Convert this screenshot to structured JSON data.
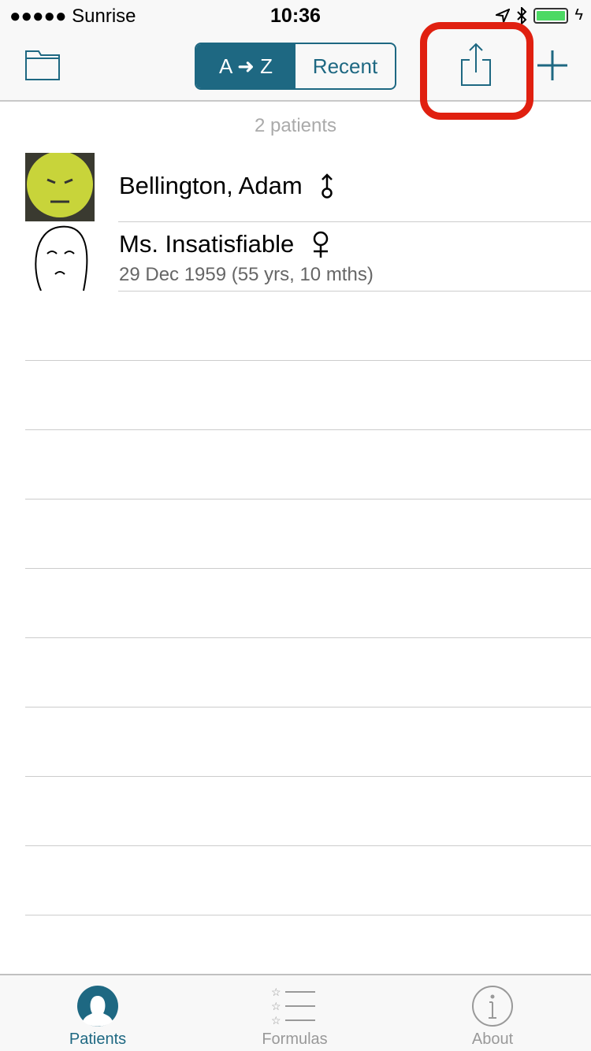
{
  "status_bar": {
    "carrier": "●●●●● Sunrise",
    "time": "10:36"
  },
  "nav": {
    "segments": [
      "A ➜ Z",
      "Recent"
    ],
    "selected": "A ➜ Z",
    "icons": [
      "folder-icon",
      "share-icon",
      "plus-icon"
    ],
    "highlight": "share-button"
  },
  "list": {
    "count": "2 patients",
    "patients": [
      {
        "name": "Bellington, Adam",
        "gender": "male",
        "dob": ""
      },
      {
        "name": "Ms. Insatisfiable",
        "gender": "female",
        "dob": "29 Dec 1959  (55 yrs, 10 mths)"
      }
    ]
  },
  "tabs": [
    {
      "label": "Patients",
      "selected": true
    },
    {
      "label": "Formulas"
    },
    {
      "label": "About"
    }
  ],
  "colors": {
    "accent": "#1e6882",
    "highlight": "#e02010"
  }
}
